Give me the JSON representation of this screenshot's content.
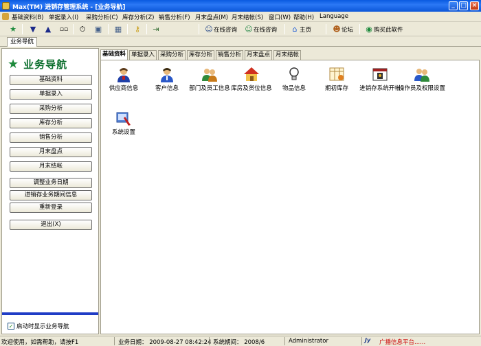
{
  "window": {
    "title": "Max(TM) 进销存管理系统 - [业务导航]"
  },
  "menu": {
    "items": [
      "基础资料(B)",
      "单据录入(I)",
      "采购分析(C)",
      "库存分析(Z)",
      "销售分析(F)",
      "月末盘点(M)",
      "月末结帐(S)",
      "窗口(W)",
      "帮助(H)",
      "Language"
    ]
  },
  "toolbar": {
    "online1": "在线咨询",
    "online2": "在线咨询",
    "home": "主页",
    "forum": "论坛",
    "buy": "购买此软件"
  },
  "navtab": {
    "label": "业务导航"
  },
  "left": {
    "title": "业务导航",
    "buttons": [
      "基础资料",
      "单据录入",
      "采购分析",
      "库存分析",
      "销售分析",
      "月末盘点",
      "月末结帐",
      "调整业务日期",
      "进销存业务期间信息",
      "重新登录",
      "退出(X)"
    ],
    "show_on_start": "启动时显示业务导航"
  },
  "right": {
    "tabs": [
      "基础资料",
      "单据录入",
      "采购分析",
      "库存分析",
      "销售分析",
      "月末盘点",
      "月末结帐"
    ],
    "items": [
      "供应商信息",
      "客户信息",
      "部门及员工信息",
      "库房及货位信息",
      "物品信息",
      "期初库存",
      "进销存系统开帐",
      "操作员及权限设置",
      "系统设置"
    ]
  },
  "status": {
    "hint": "欢迎使用，如需帮助，请按F1",
    "biz_date": "业务日期： 2009-08-27 08:42:24",
    "period": "系统期间： 2008/6",
    "user": "Administrator",
    "brand": "广播信息平台......"
  },
  "colors": {
    "title_bar": "#0a5ae0",
    "nav_title": "#0a6e2c",
    "status_brand": "#cc0000"
  }
}
